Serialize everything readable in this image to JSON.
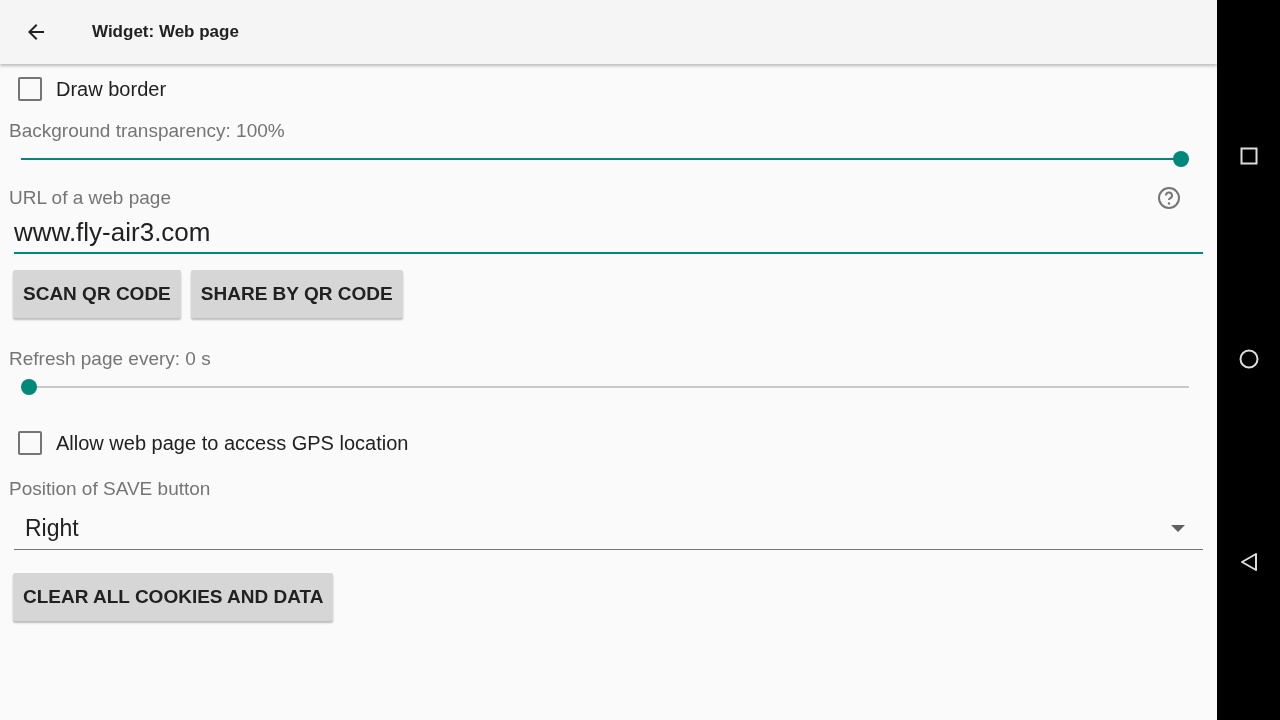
{
  "app_bar": {
    "title": "Widget: Web page"
  },
  "draw_border": {
    "label": "Draw border",
    "checked": false
  },
  "transparency": {
    "label": "Background transparency: 100%",
    "level": 1
  },
  "url": {
    "label": "URL of a web page",
    "value": "www.fly-air3.com"
  },
  "qr_buttons": [
    "SCAN QR CODE",
    "SHARE BY QR CODE"
  ],
  "refresh": {
    "label": "Refresh page every: 0 s",
    "level": 0
  },
  "gps": {
    "label": "Allow web page to access GPS location",
    "checked": false
  },
  "save_position": {
    "label": "Position of SAVE button",
    "value": "Right"
  },
  "clear_button": "CLEAR ALL COOKIES AND DATA"
}
